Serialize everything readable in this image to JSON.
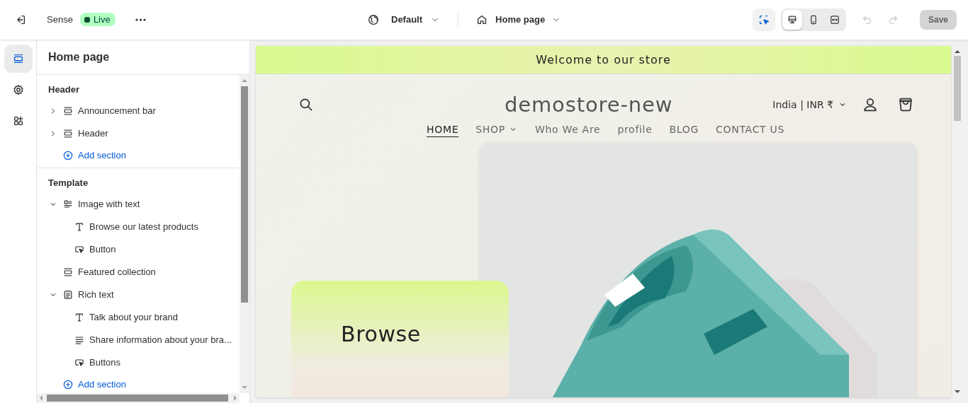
{
  "topbar": {
    "store_name": "Sense",
    "status_badge": "Live",
    "theme": "Default",
    "page": "Home page",
    "tools": [
      {
        "kind": "inspect",
        "selected": true
      }
    ],
    "devices": [
      {
        "kind": "desktop",
        "selected": true
      },
      {
        "kind": "mobile",
        "selected": false
      },
      {
        "kind": "fullwidth",
        "selected": false
      }
    ],
    "undo": {
      "disabled": true
    },
    "redo": {
      "disabled": true
    },
    "save": {
      "label": "Save",
      "disabled": true
    }
  },
  "rail": [
    {
      "kind": "sections",
      "selected": true
    },
    {
      "kind": "settings",
      "selected": false
    },
    {
      "kind": "apps",
      "selected": false
    }
  ],
  "sidebar": {
    "title": "Home page",
    "groups": [
      {
        "title": "Header",
        "items": [
          {
            "label": "Announcement bar",
            "kind": "section",
            "expanded": false
          },
          {
            "label": "Header",
            "kind": "section",
            "expanded": false
          }
        ],
        "add_label": "Add section"
      },
      {
        "title": "Template",
        "items": [
          {
            "label": "Image with text",
            "kind": "image-text",
            "expanded": true,
            "children": [
              {
                "label": "Browse our latest products",
                "kind": "text"
              },
              {
                "label": "Button",
                "kind": "button"
              }
            ]
          },
          {
            "label": "Featured collection",
            "kind": "section"
          },
          {
            "label": "Rich text",
            "kind": "rich-text",
            "expanded": true,
            "children": [
              {
                "label": "Talk about your brand",
                "kind": "text"
              },
              {
                "label": "Share information about your bra...",
                "kind": "paragraph"
              },
              {
                "label": "Buttons",
                "kind": "button"
              }
            ]
          }
        ],
        "add_label": "Add section"
      }
    ]
  },
  "preview": {
    "announcement": "Welcome to our store",
    "store_title": "demostore-new",
    "locale": "India | INR ₹",
    "nav": [
      {
        "label": "HOME",
        "selected": true
      },
      {
        "label": "SHOP",
        "has_menu": true,
        "selected": false
      },
      {
        "label": "Who We Are",
        "selected": false
      },
      {
        "label": "profile",
        "selected": false
      },
      {
        "label": "BLOG",
        "selected": false
      },
      {
        "label": "CONTACT US",
        "selected": false
      }
    ],
    "hero": {
      "heading": "Browse"
    }
  }
}
